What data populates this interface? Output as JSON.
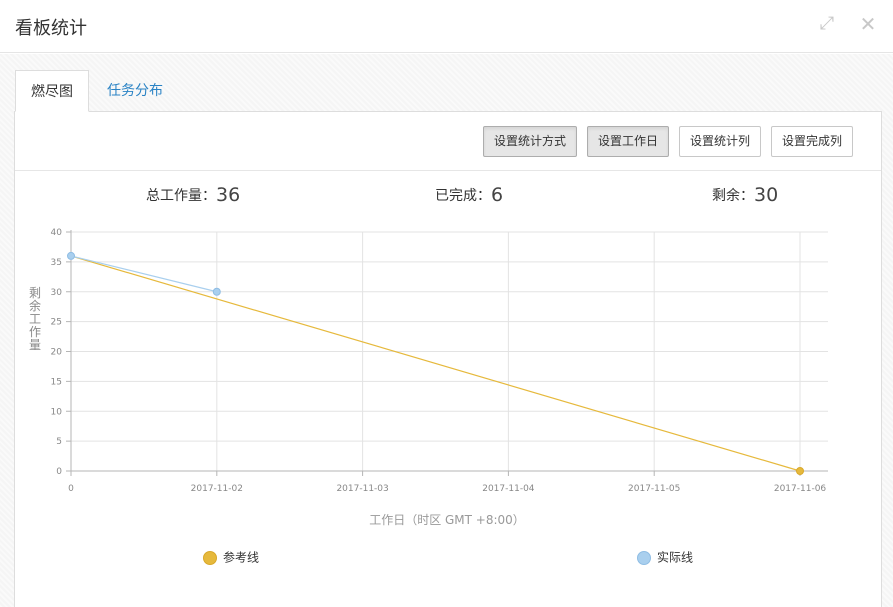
{
  "dialog": {
    "title": "看板统计"
  },
  "tabs": [
    {
      "label": "燃尽图",
      "active": true
    },
    {
      "label": "任务分布",
      "active": false
    }
  ],
  "toolbar": {
    "buttons": [
      {
        "label": "设置统计方式",
        "active": true
      },
      {
        "label": "设置工作日",
        "active": true
      },
      {
        "label": "设置统计列",
        "active": false
      },
      {
        "label": "设置完成列",
        "active": false
      }
    ]
  },
  "stats": {
    "total_label": "总工作量：",
    "total_value": "36",
    "done_label": "已完成：",
    "done_value": "6",
    "remain_label": "剩余：",
    "remain_value": "30"
  },
  "colors": {
    "reference": "#e6b93c",
    "actual": "#a9cfee",
    "tab_link": "#2a83c5"
  },
  "chart_data": {
    "type": "line",
    "xlabel": "工作日（时区 GMT +8:00）",
    "ylabel": "剩余工作量",
    "categories": [
      "0",
      "2017-11-02",
      "2017-11-03",
      "2017-11-04",
      "2017-11-05",
      "2017-11-06"
    ],
    "ylim": [
      0,
      40
    ],
    "yticks": [
      0,
      5,
      10,
      15,
      20,
      25,
      30,
      35,
      40
    ],
    "grid": true,
    "legend_position": "bottom",
    "series": [
      {
        "name": "参考线",
        "color": "#e6b93c",
        "points": [
          [
            0,
            36
          ],
          [
            5,
            0
          ]
        ]
      },
      {
        "name": "实际线",
        "color": "#a9cfee",
        "points": [
          [
            0,
            36
          ],
          [
            1,
            30
          ]
        ]
      }
    ]
  }
}
